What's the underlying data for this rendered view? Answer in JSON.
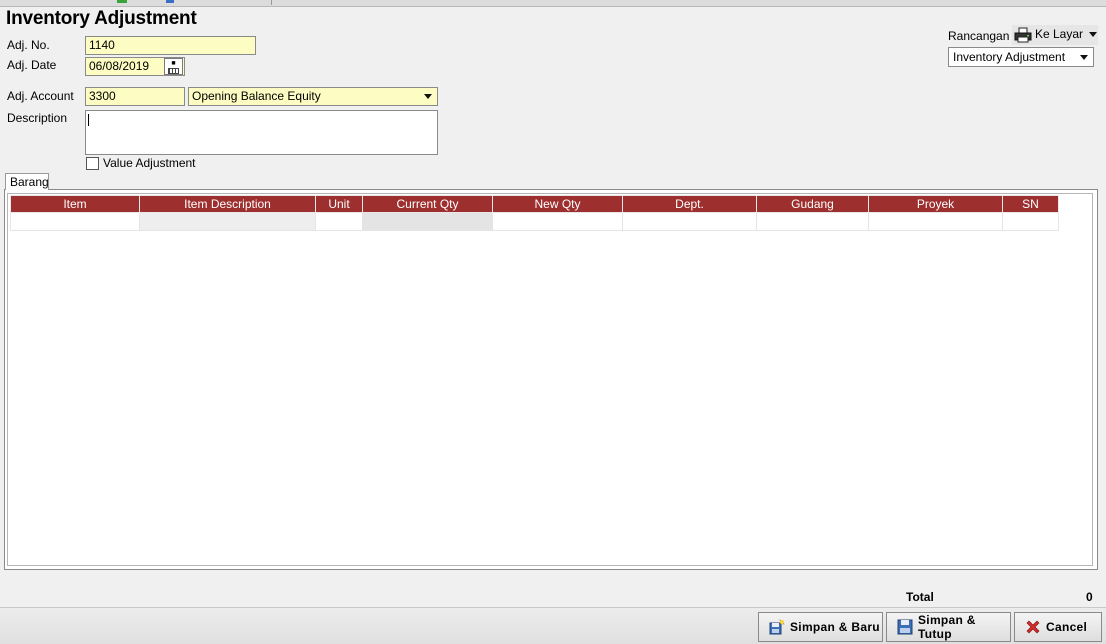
{
  "window": {
    "title": "Inventory Adjustment"
  },
  "form": {
    "adj_no_label": "Adj. No.",
    "adj_no_value": "1140",
    "adj_date_label": "Adj. Date",
    "adj_date_value": "06/08/2019",
    "adj_account_label": "Adj. Account",
    "adj_account_code": "3300",
    "adj_account_name": "Opening Balance Equity",
    "description_label": "Description",
    "description_value": "",
    "value_adjustment_label": "Value Adjustment",
    "value_adjustment_checked": false
  },
  "rancangan": {
    "label": "Rancangan",
    "output_label": "Ke Layar",
    "template_value": "Inventory Adjustment"
  },
  "tabs": [
    {
      "label": "Barang",
      "active": true
    }
  ],
  "grid": {
    "columns": [
      "Item",
      "Item Description",
      "Unit",
      "Current Qty",
      "New Qty",
      "Dept.",
      "Gudang",
      "Proyek",
      "SN"
    ],
    "header_color": "#9e2f2f"
  },
  "footer": {
    "total_label": "Total",
    "total_value": "0",
    "save_new_label": "Simpan & Baru",
    "save_close_label": "Simpan & Tutup",
    "cancel_label": "Cancel"
  }
}
